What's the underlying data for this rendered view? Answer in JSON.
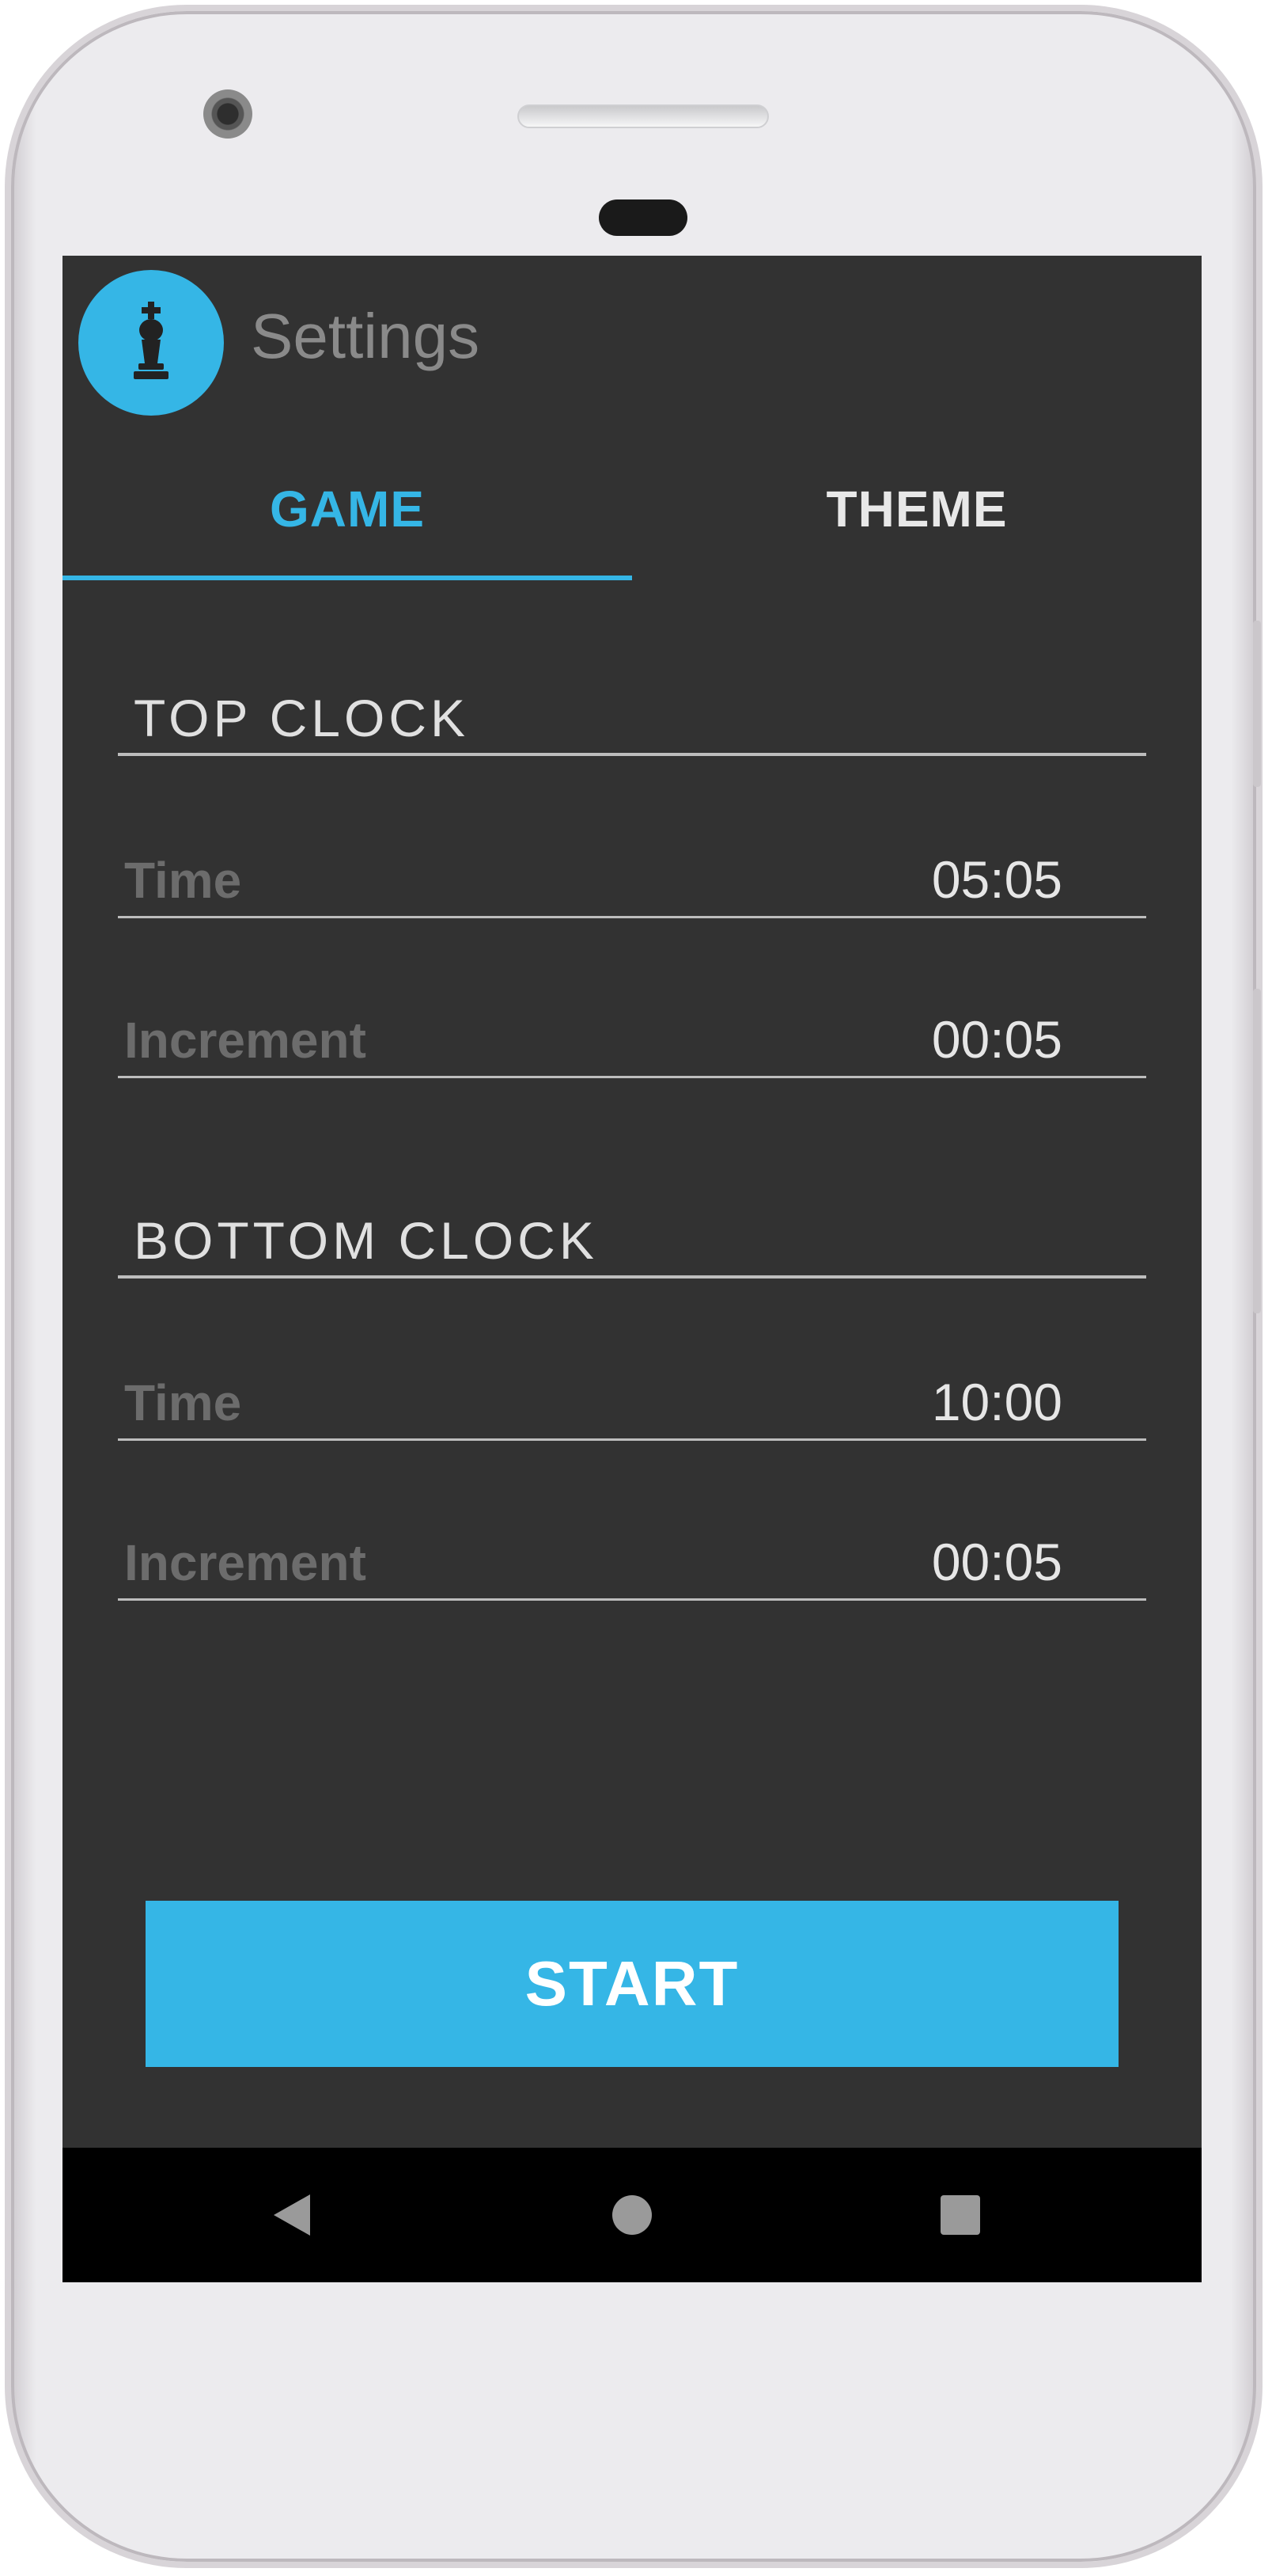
{
  "app": {
    "title": "Settings",
    "logo_icon": "chess-king-icon",
    "accent_color": "#35b6e6",
    "background_color": "#323232"
  },
  "tabs": [
    {
      "label": "GAME",
      "active": true
    },
    {
      "label": "THEME",
      "active": false
    }
  ],
  "top_clock": {
    "header": "TOP CLOCK",
    "time_label": "Time",
    "time_value": "05:05",
    "increment_label": "Increment",
    "increment_value": "00:05"
  },
  "bottom_clock": {
    "header": "BOTTOM CLOCK",
    "time_label": "Time",
    "time_value": "10:00",
    "increment_label": "Increment",
    "increment_value": "00:05"
  },
  "start_button": {
    "label": "START"
  },
  "navbar": {
    "back_icon": "back-triangle-icon",
    "home_icon": "home-circle-icon",
    "recents_icon": "recents-square-icon"
  }
}
